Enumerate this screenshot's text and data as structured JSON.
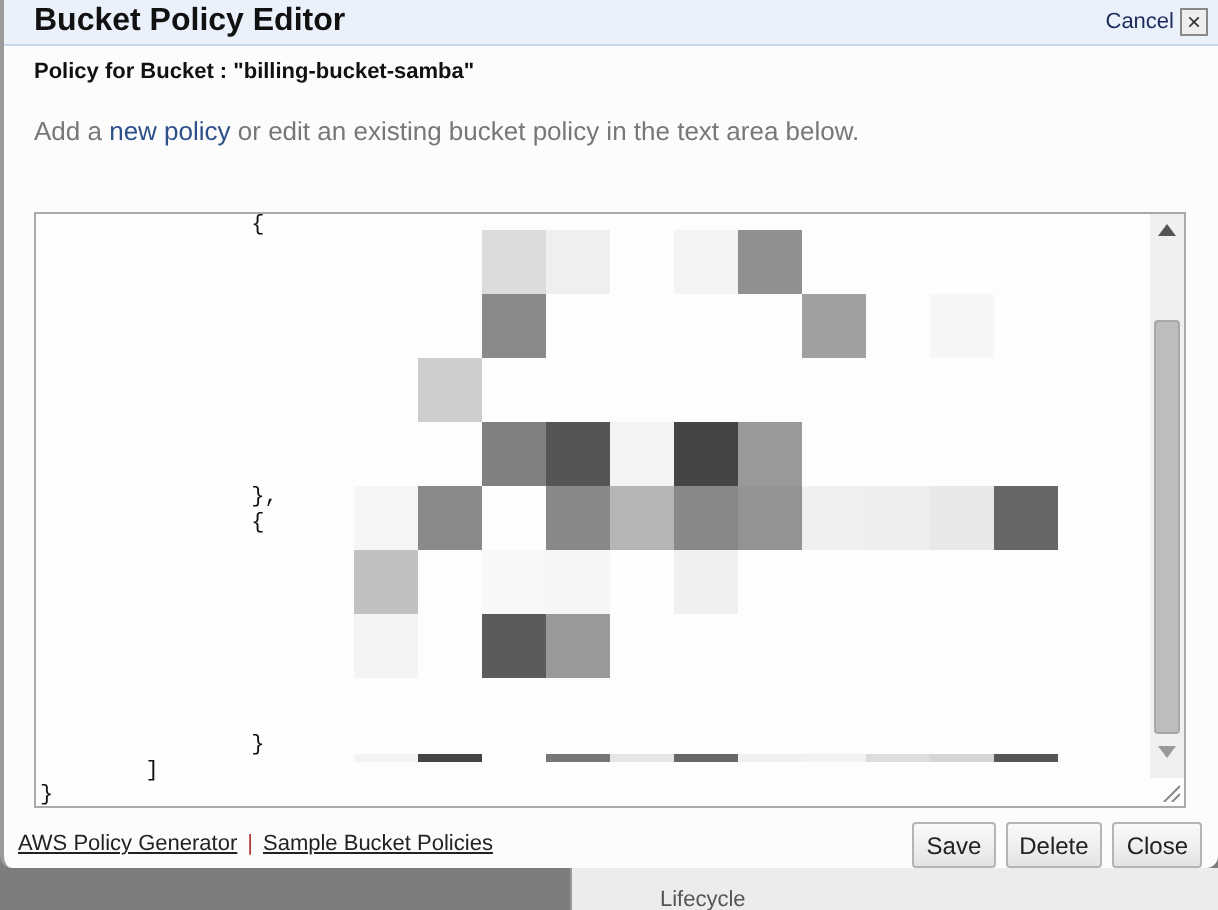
{
  "dialog": {
    "title": "Bucket Policy Editor",
    "cancel": "Cancel",
    "close_icon": "×"
  },
  "policy_heading": "Policy for Bucket : \"billing-bucket-samba\"",
  "description": [
    {
      "text": "Add a "
    },
    {
      "text": "new policy",
      "kind": "link"
    },
    {
      "text": " or edit an existing bucket policy in the text area below."
    }
  ],
  "editor": {
    "code": "                {\n\n\n\n\n\n\n\n\n\n\n                },\n                {\n\n\n\n\n\n\n\n\n                }\n        ]\n}"
  },
  "links": [
    "AWS Policy Generator",
    "Sample Bucket Policies"
  ],
  "link_separator": "|",
  "buttons": [
    "Save",
    "Delete",
    "Close"
  ],
  "background": {
    "section_label": "Lifecycle"
  }
}
